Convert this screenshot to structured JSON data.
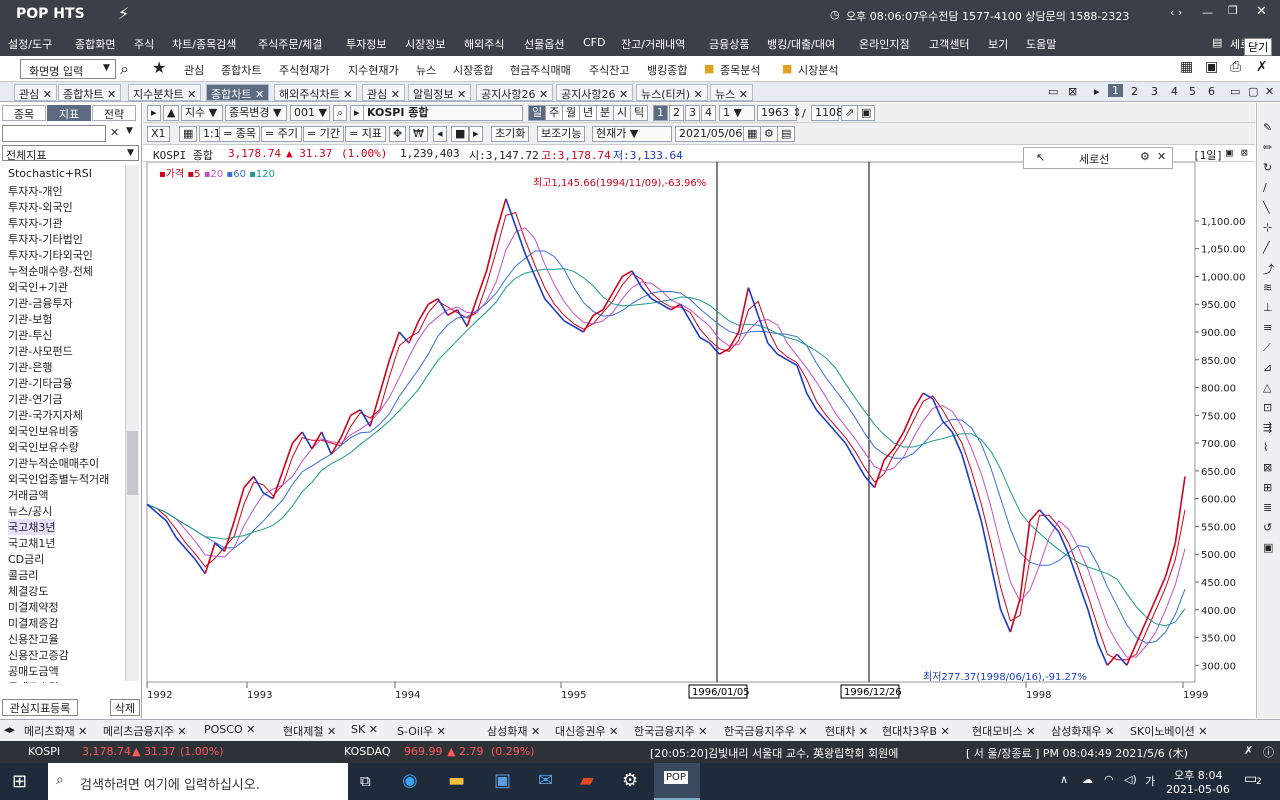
{
  "app": {
    "logo": "POP HTS",
    "time": "오후 08:06:07",
    "phone": "우수전담 1577-4100 상담문의 1588-2323"
  },
  "menu": [
    "설정/도구",
    "종합화면",
    "주식",
    "차트/종목검색",
    "주식주문/체결",
    "투자정보",
    "시장정보",
    "해외주식",
    "선물옵션",
    "CFD",
    "잔고/거래내역",
    "금융상품",
    "뱅킹/대출/대여",
    "온라인지점",
    "고객센터",
    "보기",
    "도움말"
  ],
  "menu_right": "세로",
  "tooltip": "닫기",
  "quick": {
    "screen_input": "화면명 입력",
    "items": [
      "관심",
      "종합차트",
      "주식현재가",
      "지수현재가",
      "뉴스",
      "시장종합",
      "현금주식매매",
      "주식잔고",
      "뱅킹종합",
      "종목분석",
      "시장분석"
    ]
  },
  "tabs": [
    "관심",
    "종합차트",
    "지수분차트",
    "종합차트",
    "해외주식차트",
    "관심",
    "알림정보",
    "공지사항26",
    "공지사항26",
    "뉴스(티커)",
    "뉴스"
  ],
  "tab_pages": [
    "1",
    "2",
    "3",
    "4",
    "5",
    "6"
  ],
  "left": {
    "tabs": [
      "종목",
      "지표",
      "전략"
    ],
    "category": "전체지표",
    "items": [
      "Stochastic+RSI",
      "투자자-개인",
      "투자자-외국인",
      "투자자-기관",
      "투자자-기타법인",
      "투자자-기타외국인",
      "누적순매수량-전체",
      "외국인+기관",
      "기관-금융투자",
      "기관-보험",
      "기관-투신",
      "기관-사모펀드",
      "기관-은행",
      "기관-기타금융",
      "기관-연기금",
      "기관-국가지자체",
      "외국인보유비중",
      "외국인보유수량",
      "기관누적순매매추이",
      "외국인업종별누적거래",
      "거래금액",
      "뉴스/공시",
      "국고채3년",
      "국고채1년",
      "CD금리",
      "콜금리",
      "체결강도",
      "미결제약정",
      "미결제증감",
      "신용잔고율",
      "신용잔고증감",
      "공매도금액",
      "공매도수량"
    ],
    "register": "관심지표등록",
    "delete": "삭제"
  },
  "toolbar": {
    "type": "지수",
    "change": "종목변경",
    "code": "001",
    "name": "KOSPI 종합",
    "periods": [
      "일",
      "주",
      "월",
      "년",
      "분",
      "시",
      "틱"
    ],
    "nums": [
      "1",
      "2",
      "3",
      "4"
    ],
    "count1": "1",
    "count2": "1963",
    "count3": "1108",
    "x1": "X1",
    "mode": "현재가",
    "date": "2021/05/06",
    "filters": [
      "= 종목",
      "= 주기",
      "= 기간",
      "= 지표"
    ],
    "reset": "초기화",
    "aux": "보조기능"
  },
  "info": {
    "name": "KOSPI 종합",
    "price": "3,178.74",
    "chg": "▲ 31.37",
    "pct": "(1.00%)",
    "vol": "1,239,403",
    "open": "시:3,147.72",
    "high": "고:3,178.74",
    "low": "저:3,133.64",
    "period": "[1일]"
  },
  "legend": {
    "label": "가격",
    "ma": [
      "5",
      "20",
      "60",
      "120"
    ]
  },
  "chart_data": {
    "type": "line",
    "title": "KOSPI 종합",
    "y_ticks": [
      "1,100.00",
      "1,050.00",
      "1,000.00",
      "950.00",
      "900.00",
      "850.00",
      "800.00",
      "750.00",
      "700.00",
      "650.00",
      "600.00",
      "550.00",
      "500.00",
      "450.00",
      "400.00",
      "350.00",
      "300.00"
    ],
    "x_ticks": [
      "1992",
      "1993",
      "1994",
      "1995",
      "1998",
      "1999"
    ],
    "markers": [
      "1996/01/05",
      "1996/12/26"
    ],
    "high_label": "최고1,145.66(1994/11/09),-63.96%",
    "low_label": "최저277.37(1998/06/16),-91.27%",
    "series": [
      {
        "name": "가격",
        "values": [
          590,
          575,
          560,
          530,
          510,
          490,
          465,
          520,
          505,
          560,
          620,
          640,
          610,
          600,
          650,
          700,
          720,
          690,
          720,
          680,
          710,
          750,
          760,
          730,
          790,
          850,
          900,
          880,
          920,
          950,
          960,
          930,
          940,
          910,
          960,
          1010,
          1080,
          1140,
          1090,
          1040,
          1000,
          960,
          940,
          920,
          910,
          900,
          930,
          940,
          970,
          1000,
          1010,
          980,
          960,
          950,
          940,
          950,
          920,
          890,
          880,
          860,
          870,
          900,
          980,
          930,
          880,
          860,
          850,
          840,
          790,
          760,
          740,
          720,
          700,
          670,
          640,
          620,
          670,
          690,
          720,
          760,
          790,
          780,
          740,
          720,
          680,
          620,
          560,
          480,
          400,
          360,
          420,
          560,
          580,
          560,
          540,
          500,
          450,
          400,
          340,
          300,
          320,
          300,
          340,
          380,
          420,
          460,
          520,
          640
        ]
      }
    ],
    "ylim": [
      270,
      1170
    ]
  },
  "drawing_panel": {
    "title": "세로선"
  },
  "bottom_tabs": [
    "메리츠화재",
    "메리츠금융지주",
    "POSCO",
    "현대제철",
    "SK",
    "S-Oil우",
    "삼성화재",
    "대신증권우",
    "한국금융지주",
    "한국금융지주우",
    "현대차",
    "현대차3우B",
    "현대모비스",
    "삼성화재우",
    "SK이노베이션"
  ],
  "ticker": {
    "kospi_label": "KOSPI",
    "kospi_val": "3,178.74",
    "kospi_chg": "▲ 31.37",
    "kospi_pct": "(1.00%)",
    "kosdaq_label": "KOSDAQ",
    "kosdaq_val": "969.99",
    "kosdaq_chg": "▲ 2.79",
    "kosdaq_pct": "(0.29%)",
    "news": "[20:05:20]김빛내리 서울대 교수, 英왕립학회 회원에",
    "status": "[ 서  울/장종료 ] PM 08:04:49  2021/5/6 (木)"
  },
  "taskbar": {
    "search": "검색하려면 여기에 입력하십시오.",
    "time": "오후 8:04",
    "date": "2021-05-06",
    "lang": "가",
    "notif": "2"
  },
  "colors": {
    "up": "#d0021b",
    "down": "#1a3cc8",
    "ma5": "#d0021b",
    "ma20": "#c850c8",
    "ma60": "#3a6fd8",
    "ma120": "#1a9a8a"
  }
}
